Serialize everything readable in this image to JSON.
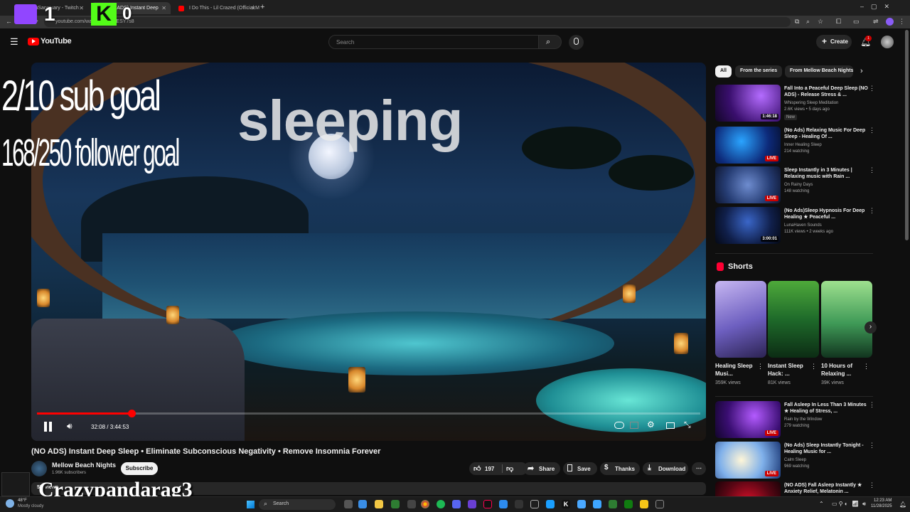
{
  "browser": {
    "tabs": [
      {
        "label": "youSanctuary - Twitch"
      },
      {
        "label": "(NO ADS) Instant Deep"
      },
      {
        "label": "I Do This - Lil Crazed (Official M"
      }
    ],
    "url": "youtube.com/watch?v=...17ESY7s8"
  },
  "stream_overlay": {
    "sub_count": "1",
    "k_label": "K",
    "zero": "0",
    "sub_goal": "2/10 sub goal",
    "follower_goal": "168/250 follower goal",
    "status_text": "sleeping",
    "streamer_name": "Crazypandarag3"
  },
  "youtube": {
    "logo": "YouTube",
    "search_placeholder": "Search",
    "create_label": "Create",
    "notification_count": "1"
  },
  "player": {
    "time": "32:08 / 3:44:53",
    "progress_fraction": 0.143
  },
  "video": {
    "title": "(NO ADS) Instant Deep Sleep • Eliminate Subconscious Negativity • Remove Insomnia Forever",
    "channel": "Mellow Beach Nights",
    "subscribers": "1.96K subscribers",
    "subscribe_label": "Subscribe",
    "likes": "197",
    "share_label": "Share",
    "save_label": "Save",
    "thanks_label": "Thanks",
    "download_label": "Download",
    "views_partial": "5K views"
  },
  "sidebar": {
    "chips": [
      "All",
      "From the series",
      "From Mellow Beach Nights"
    ],
    "recs": [
      {
        "title": "Fall Into a Peaceful Deep Sleep (NO ADS) - Release Stress & ...",
        "channel": "Whispering Sleep Meditation",
        "meta": "2.6K views • 5 days ago",
        "badge": "1:46:18",
        "new": "New"
      },
      {
        "title": "(No Ads) Relaxing Music For Deep Sleep - Healing Of ...",
        "channel": "Inner Healing Sleep",
        "meta": "214 watching",
        "badge": "LIVE"
      },
      {
        "title": "Sleep Instantly in 3 Minutes | Relaxing music with Rain ...",
        "channel": "On Rainy Days",
        "meta": "148 watching",
        "badge": "LIVE"
      },
      {
        "title": "(No Ads)Sleep Hypnosis For Deep Healing ★ Peaceful ...",
        "channel": "LunaHaven Sounds",
        "meta": "111K views • 2 weeks ago",
        "badge": "3:00:01"
      }
    ],
    "shorts_heading": "Shorts",
    "shorts": [
      {
        "title": "Healing Sleep Musi...",
        "views": "359K views"
      },
      {
        "title": "Instant Sleep Hack: ...",
        "views": "81K views"
      },
      {
        "title": "10 Hours of Relaxing ...",
        "views": "39K views"
      }
    ],
    "recs2": [
      {
        "title": "Fall Asleep In Less Than 3 Minutes ★ Healing of Stress, ...",
        "channel": "Rain by the Window",
        "meta": "279 watching",
        "badge": "LIVE"
      },
      {
        "title": "(No Ads) Sleep Instantly Tonight - Healing Music for ...",
        "channel": "Calm Sleep",
        "meta": "969 watching",
        "badge": "LIVE"
      },
      {
        "title": "(NO ADS) Fall Asleep Instantly ★ Anxiety Relief, Melatonin ...",
        "channel": "",
        "meta": "",
        "badge": "LIVE"
      }
    ]
  },
  "taskbar": {
    "weather_temp": "48°F",
    "weather_desc": "Mostly cloudy",
    "search_label": "Search",
    "time": "12:23 AM",
    "date": "11/28/2025"
  },
  "colors": {
    "accent": "#ff0000",
    "twitch": "#9146ff",
    "kick": "#53fc18"
  }
}
